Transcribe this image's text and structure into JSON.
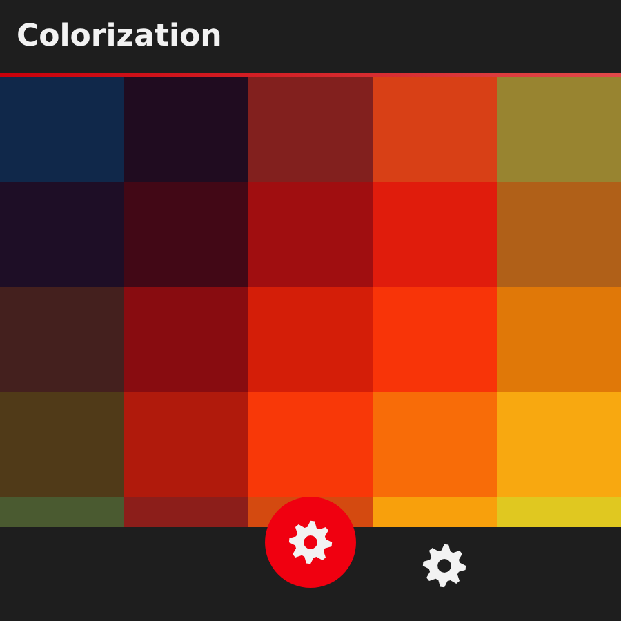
{
  "title": "Colorization",
  "grid": [
    [
      {
        "color": "#10284a"
      },
      {
        "color": "#200c20"
      },
      {
        "color": "#82201e"
      },
      {
        "color": "#d84016"
      },
      {
        "color": "#988430"
      }
    ],
    [
      {
        "color": "#1e0e26"
      },
      {
        "color": "#420816"
      },
      {
        "color": "#a00e10"
      },
      {
        "color": "#e01c0c"
      },
      {
        "color": "#b06018"
      }
    ],
    [
      {
        "color": "#44201e"
      },
      {
        "color": "#880c10"
      },
      {
        "color": "#d41e08"
      },
      {
        "color": "#f83408"
      },
      {
        "color": "#e07808"
      }
    ],
    [
      {
        "color": "#503a18"
      },
      {
        "color": "#b01a0c"
      },
      {
        "color": "#f83808"
      },
      {
        "color": "#f86c08"
      },
      {
        "color": "#f8a810"
      }
    ],
    [
      {
        "color": "#4a5a30"
      },
      {
        "color": "#8c1e1a"
      },
      {
        "color": "#d44a10"
      },
      {
        "color": "#f8a00c"
      },
      {
        "color": "#e0c820"
      }
    ]
  ]
}
